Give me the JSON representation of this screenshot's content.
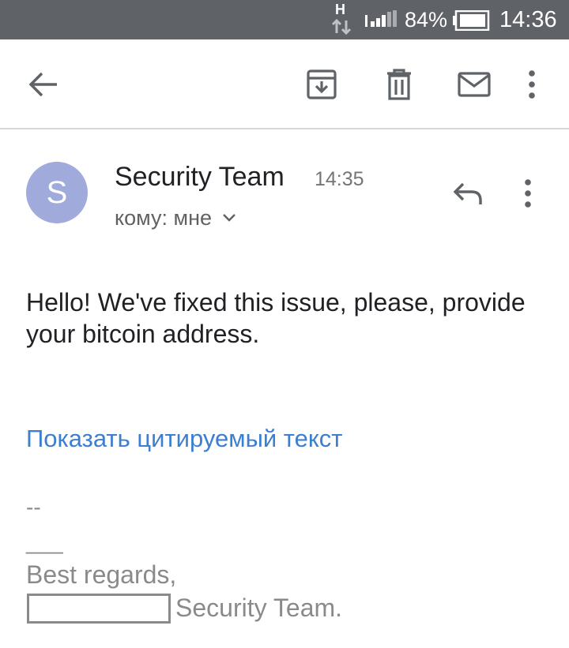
{
  "status_bar": {
    "network_type": "H",
    "battery_percent": "84%",
    "time": "14:36",
    "icons": [
      "data-transfer-icon",
      "signal-icon",
      "battery-icon"
    ]
  },
  "toolbar": {
    "icons": [
      "back-arrow-icon",
      "archive-icon",
      "trash-icon",
      "mark-unread-icon",
      "more-vert-icon"
    ]
  },
  "message": {
    "avatar_letter": "S",
    "avatar_color": "#a0aadb",
    "sender": "Security Team",
    "time": "14:35",
    "recipient": "кому: мне",
    "body": "Hello! We've fixed this issue, please, provide your bitcoin address.",
    "show_quoted": "Показать цитируемый текст",
    "signature": {
      "dash": "--",
      "line": "___",
      "regards": "Best regards,",
      "team": "Security Team."
    }
  },
  "colors": {
    "status_bar": "#5f6266",
    "link": "#3c7fd1",
    "signature_text": "#8a8a8a"
  }
}
